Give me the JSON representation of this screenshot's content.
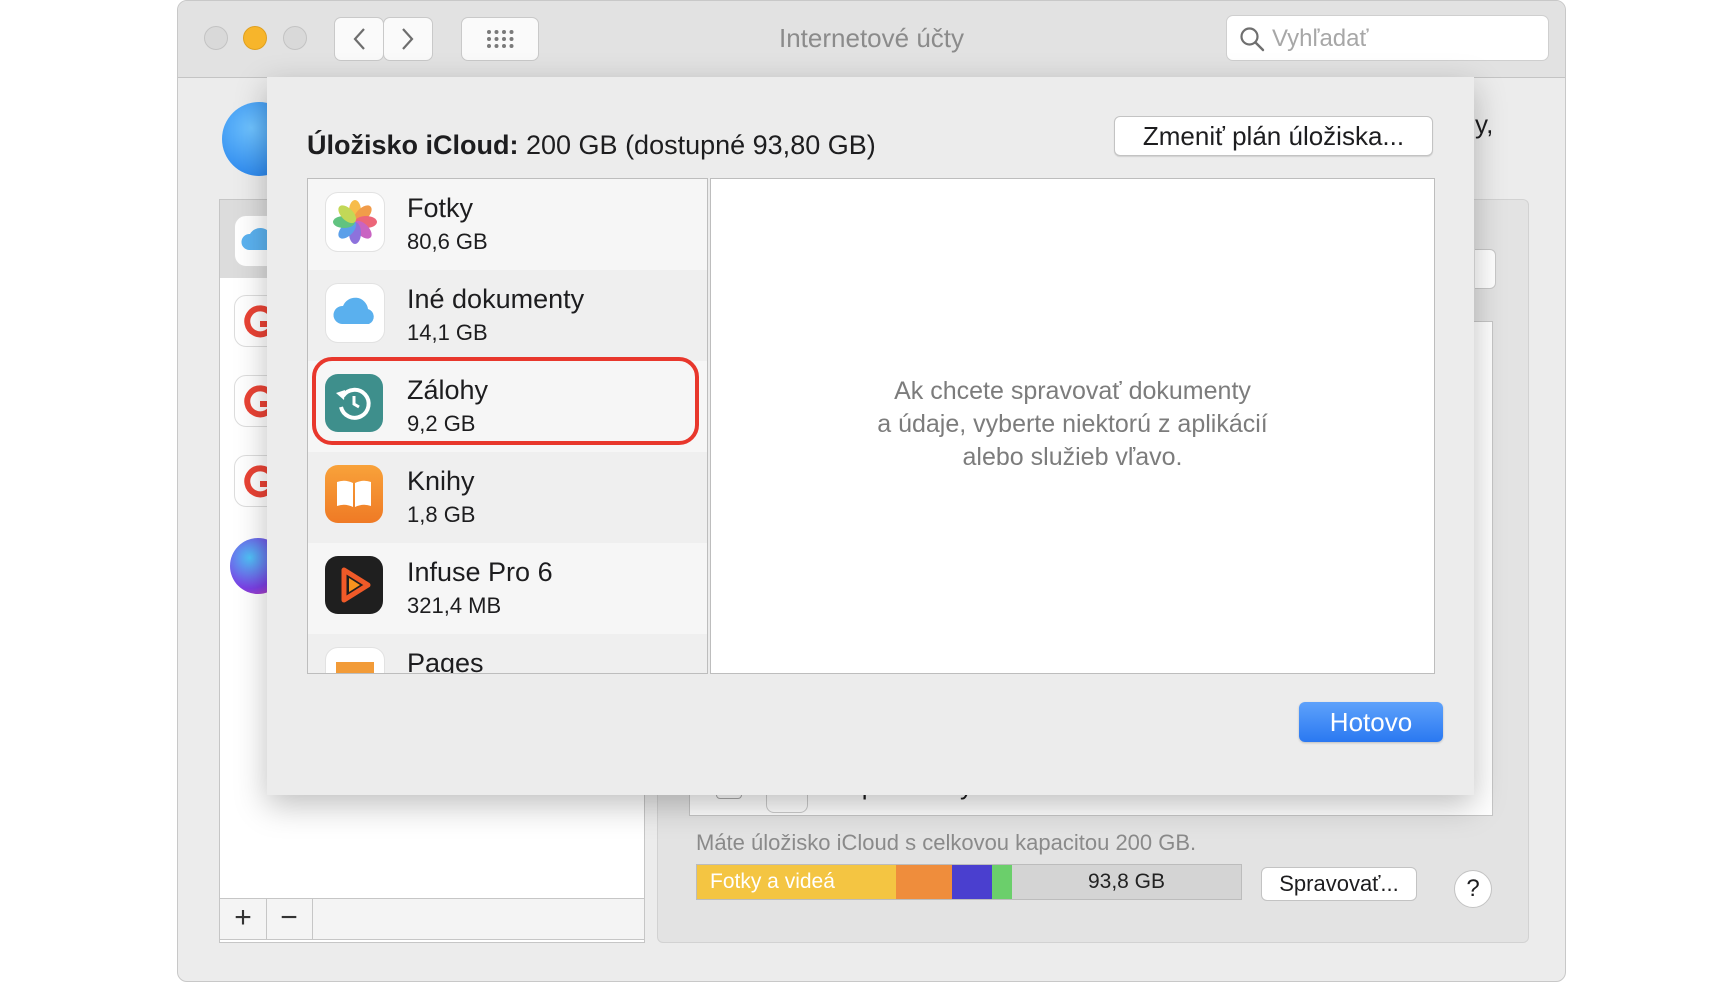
{
  "window": {
    "title": "Internetové účty"
  },
  "toolbar": {
    "search_placeholder": "Vyhľadať"
  },
  "background": {
    "peek_text": "y,",
    "partial_item": "Pripomienky",
    "storage_summary": "Máte úložisko iCloud s celkovou kapacitou 200 GB.",
    "bar_label": "Fotky a videá",
    "bar_available": "93,8 GB",
    "manage_label": "Spravovať...",
    "help_label": "?",
    "add_label": "+",
    "remove_label": "−",
    "bar_colors": {
      "photos": "#f4c542",
      "orange": "#ef8d3c",
      "blue": "#4a3fcf",
      "green": "#6bcf6b",
      "free": "#d4d4d4"
    }
  },
  "sheet": {
    "title_bold": "Úložisko iCloud:",
    "title_rest": " 200 GB (dostupné 93,80 GB)",
    "change_plan_label": "Zmeniť plán úložiska...",
    "apps": [
      {
        "name": "Fotky",
        "size": "80,6 GB",
        "icon": "photos-icon"
      },
      {
        "name": "Iné dokumenty",
        "size": "14,1 GB",
        "icon": "icloud-icon"
      },
      {
        "name": "Zálohy",
        "size": "9,2 GB",
        "icon": "backup-icon"
      },
      {
        "name": "Knihy",
        "size": "1,8 GB",
        "icon": "books-icon"
      },
      {
        "name": "Infuse Pro 6",
        "size": "321,4 MB",
        "icon": "infuse-icon"
      },
      {
        "name": "Pages",
        "size": "",
        "icon": "pages-icon"
      }
    ],
    "detail_message": [
      "Ak chcete spravovať dokumenty",
      "a údaje, vyberte niektorú z aplikácií",
      "alebo služieb vľavo."
    ],
    "done_label": "Hotovo",
    "accent_color": "#2a78f1",
    "highlight_color": "#e8372c"
  }
}
